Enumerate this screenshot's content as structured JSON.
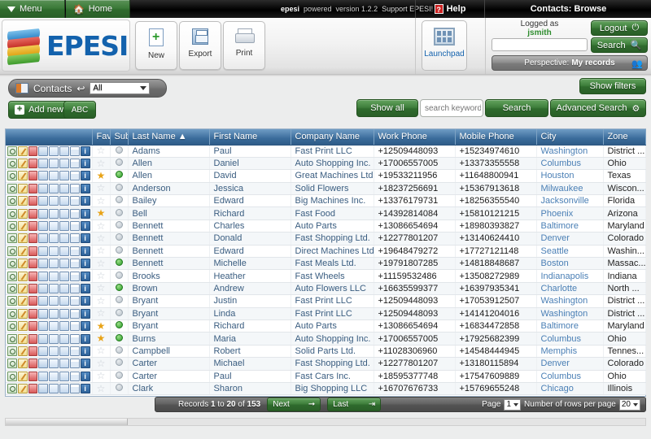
{
  "topbar": {
    "menu_label": "Menu",
    "home_label": "Home",
    "brand": "epesi",
    "brand_suffix": "powered",
    "version": "version 1.2.2",
    "support": "Support EPESI!",
    "help_label": "Help",
    "help_icon": "question-mark-icon",
    "module_title": "Contacts: Browse"
  },
  "toolbar": {
    "new_label": "New",
    "export_label": "Export",
    "print_label": "Print",
    "launchpad_label": "Launchpad",
    "logo_text": "EPESI"
  },
  "login": {
    "logged_as_label": "Logged as",
    "username": "jsmith",
    "user_field_value": "",
    "logout_label": "Logout",
    "search_label": "Search",
    "perspective_label": "Perspective:",
    "perspective_value": "My records"
  },
  "crumb": {
    "icon": "contacts-card-icon",
    "label": "Contacts",
    "arrow": "↩",
    "filter_value": "All"
  },
  "actions": {
    "add_new_label": "Add new",
    "abc_label": "ABC",
    "show_filters_label": "Show filters",
    "show_all_label": "Show all",
    "search_placeholder": "search keyword...",
    "search_value": "",
    "search_label": "Search",
    "advanced_search_label": "Advanced Search"
  },
  "table": {
    "columns": [
      {
        "key": "actions",
        "label": ""
      },
      {
        "key": "fav",
        "label": "Fav"
      },
      {
        "key": "sub",
        "label": "Sub"
      },
      {
        "key": "last_name",
        "label": "Last Name ▲"
      },
      {
        "key": "first_name",
        "label": "First Name"
      },
      {
        "key": "company",
        "label": "Company Name"
      },
      {
        "key": "work_phone",
        "label": "Work Phone"
      },
      {
        "key": "mobile_phone",
        "label": "Mobile Phone"
      },
      {
        "key": "city",
        "label": "City"
      },
      {
        "key": "zone",
        "label": "Zone"
      }
    ],
    "row_icons": [
      "view-icon",
      "edit-icon",
      "delete-icon",
      "copy-icon",
      "note-icon",
      "duplicate-icon",
      "calendar-icon",
      "info-icon"
    ],
    "rows": [
      {
        "fav": false,
        "sub": false,
        "last_name": "Adams",
        "first_name": "Paul",
        "company": "Fast Print LLC",
        "work_phone": "+12509448093",
        "mobile_phone": "+15234974610",
        "city": "Washington",
        "zone": "District ..."
      },
      {
        "fav": false,
        "sub": false,
        "last_name": "Allen",
        "first_name": "Daniel",
        "company": "Auto Shopping Inc.",
        "work_phone": "+17006557005",
        "mobile_phone": "+13373355558",
        "city": "Columbus",
        "zone": "Ohio"
      },
      {
        "fav": true,
        "sub": true,
        "last_name": "Allen",
        "first_name": "David",
        "company": "Great Machines Ltd.",
        "work_phone": "+19533211956",
        "mobile_phone": "+11648800941",
        "city": "Houston",
        "zone": "Texas"
      },
      {
        "fav": false,
        "sub": false,
        "last_name": "Anderson",
        "first_name": "Jessica",
        "company": "Solid Flowers",
        "work_phone": "+18237256691",
        "mobile_phone": "+15367913618",
        "city": "Milwaukee",
        "zone": "Wiscon..."
      },
      {
        "fav": false,
        "sub": false,
        "last_name": "Bailey",
        "first_name": "Edward",
        "company": "Big Machines Inc.",
        "work_phone": "+13376179731",
        "mobile_phone": "+18256355540",
        "city": "Jacksonville",
        "zone": "Florida"
      },
      {
        "fav": true,
        "sub": false,
        "last_name": "Bell",
        "first_name": "Richard",
        "company": "Fast Food",
        "work_phone": "+14392814084",
        "mobile_phone": "+15810121215",
        "city": "Phoenix",
        "zone": "Arizona"
      },
      {
        "fav": false,
        "sub": false,
        "last_name": "Bennett",
        "first_name": "Charles",
        "company": "Auto Parts",
        "work_phone": "+13086654694",
        "mobile_phone": "+18980393827",
        "city": "Baltimore",
        "zone": "Maryland"
      },
      {
        "fav": false,
        "sub": false,
        "last_name": "Bennett",
        "first_name": "Donald",
        "company": "Fast Shopping Ltd.",
        "work_phone": "+12277801207",
        "mobile_phone": "+13140624410",
        "city": "Denver",
        "zone": "Colorado"
      },
      {
        "fav": false,
        "sub": false,
        "last_name": "Bennett",
        "first_name": "Edward",
        "company": "Direct Machines Ltd.",
        "work_phone": "+19648479272",
        "mobile_phone": "+17727121148",
        "city": "Seattle",
        "zone": "Washin..."
      },
      {
        "fav": false,
        "sub": true,
        "last_name": "Bennett",
        "first_name": "Michelle",
        "company": "Fast Meals Ltd.",
        "work_phone": "+19791807285",
        "mobile_phone": "+14818848687",
        "city": "Boston",
        "zone": "Massac..."
      },
      {
        "fav": false,
        "sub": false,
        "last_name": "Brooks",
        "first_name": "Heather",
        "company": "Fast Wheels",
        "work_phone": "+11159532486",
        "mobile_phone": "+13508272989",
        "city": "Indianapolis",
        "zone": "Indiana"
      },
      {
        "fav": false,
        "sub": true,
        "last_name": "Brown",
        "first_name": "Andrew",
        "company": "Auto Flowers LLC",
        "work_phone": "+16635599377",
        "mobile_phone": "+16397935341",
        "city": "Charlotte",
        "zone": "North ..."
      },
      {
        "fav": false,
        "sub": false,
        "last_name": "Bryant",
        "first_name": "Justin",
        "company": "Fast Print LLC",
        "work_phone": "+12509448093",
        "mobile_phone": "+17053912507",
        "city": "Washington",
        "zone": "District ..."
      },
      {
        "fav": false,
        "sub": false,
        "last_name": "Bryant",
        "first_name": "Linda",
        "company": "Fast Print LLC",
        "work_phone": "+12509448093",
        "mobile_phone": "+14141204016",
        "city": "Washington",
        "zone": "District ..."
      },
      {
        "fav": true,
        "sub": true,
        "last_name": "Bryant",
        "first_name": "Richard",
        "company": "Auto Parts",
        "work_phone": "+13086654694",
        "mobile_phone": "+16834472858",
        "city": "Baltimore",
        "zone": "Maryland"
      },
      {
        "fav": true,
        "sub": true,
        "last_name": "Burns",
        "first_name": "Maria",
        "company": "Auto Shopping Inc.",
        "work_phone": "+17006557005",
        "mobile_phone": "+17925682399",
        "city": "Columbus",
        "zone": "Ohio"
      },
      {
        "fav": false,
        "sub": false,
        "last_name": "Campbell",
        "first_name": "Robert",
        "company": "Solid Parts Ltd.",
        "work_phone": "+11028306960",
        "mobile_phone": "+14548444945",
        "city": "Memphis",
        "zone": "Tennes..."
      },
      {
        "fav": false,
        "sub": false,
        "last_name": "Carter",
        "first_name": "Michael",
        "company": "Fast Shopping Ltd.",
        "work_phone": "+12277801207",
        "mobile_phone": "+13180115894",
        "city": "Denver",
        "zone": "Colorado"
      },
      {
        "fav": false,
        "sub": false,
        "last_name": "Carter",
        "first_name": "Paul",
        "company": "Fast Cars Inc.",
        "work_phone": "+18595377748",
        "mobile_phone": "+17547609889",
        "city": "Columbus",
        "zone": "Ohio"
      },
      {
        "fav": false,
        "sub": false,
        "last_name": "Clark",
        "first_name": "Sharon",
        "company": "Big Shopping LLC",
        "work_phone": "+16707676733",
        "mobile_phone": "+15769655248",
        "city": "Chicago",
        "zone": "Illinois"
      }
    ]
  },
  "pager": {
    "records_prefix": "Records",
    "records_from": "1",
    "records_to_word": "to",
    "records_to": "20",
    "records_of_word": "of",
    "records_total": "153",
    "next_label": "Next",
    "last_label": "Last",
    "page_label": "Page",
    "page_value": "1",
    "rows_label": "Number of rows per page",
    "rows_value": "20"
  },
  "colors": {
    "green": "#2f6b2d",
    "header_blue": "#3a6b9a",
    "brand_blue": "#1362ad",
    "star_gold": "#e8a317",
    "sub_green": "#2a9a26"
  }
}
